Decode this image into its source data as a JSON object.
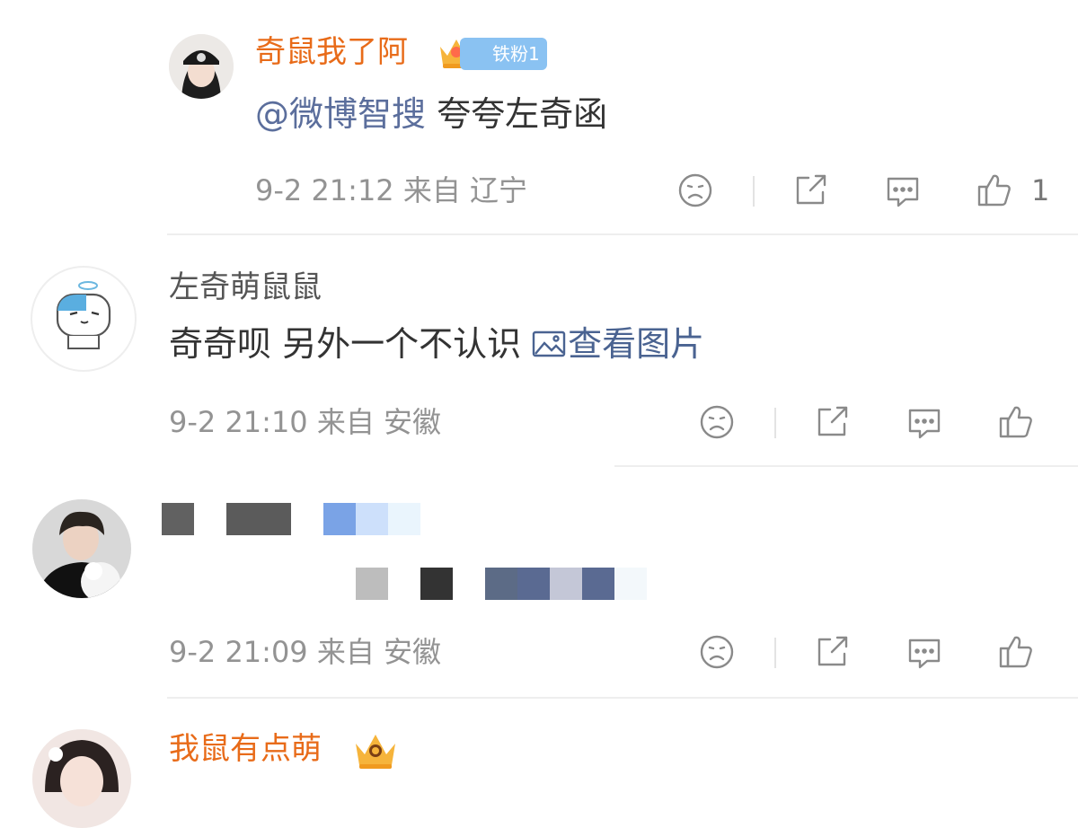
{
  "comments": [
    {
      "username": "奇鼠我了阿",
      "badge": "铁粉1",
      "mention": "@微博智搜",
      "text": "夸夸左奇函",
      "time": "9-2 21:12",
      "location": "来自 辽宁",
      "like_count": "1"
    },
    {
      "username": "左奇萌鼠鼠",
      "text": "奇奇呗 另外一个不认识 ",
      "view_image": "查看图片",
      "time": "9-2 21:10",
      "location": "来自 安徽"
    },
    {
      "time": "9-2 21:09",
      "location": "来自 安徽"
    },
    {
      "username": "我鼠有点萌"
    }
  ],
  "icons": {
    "emoji": "sad-face-icon",
    "share": "share-icon",
    "reply": "comment-icon",
    "like": "thumbs-up-icon",
    "crown": "crown-icon",
    "image": "image-icon"
  },
  "colors": {
    "username_orange": "#e86b19",
    "mention_blue": "#5b6e9c",
    "meta_gray": "#939393",
    "badge_blue": "#8ac2f2"
  }
}
